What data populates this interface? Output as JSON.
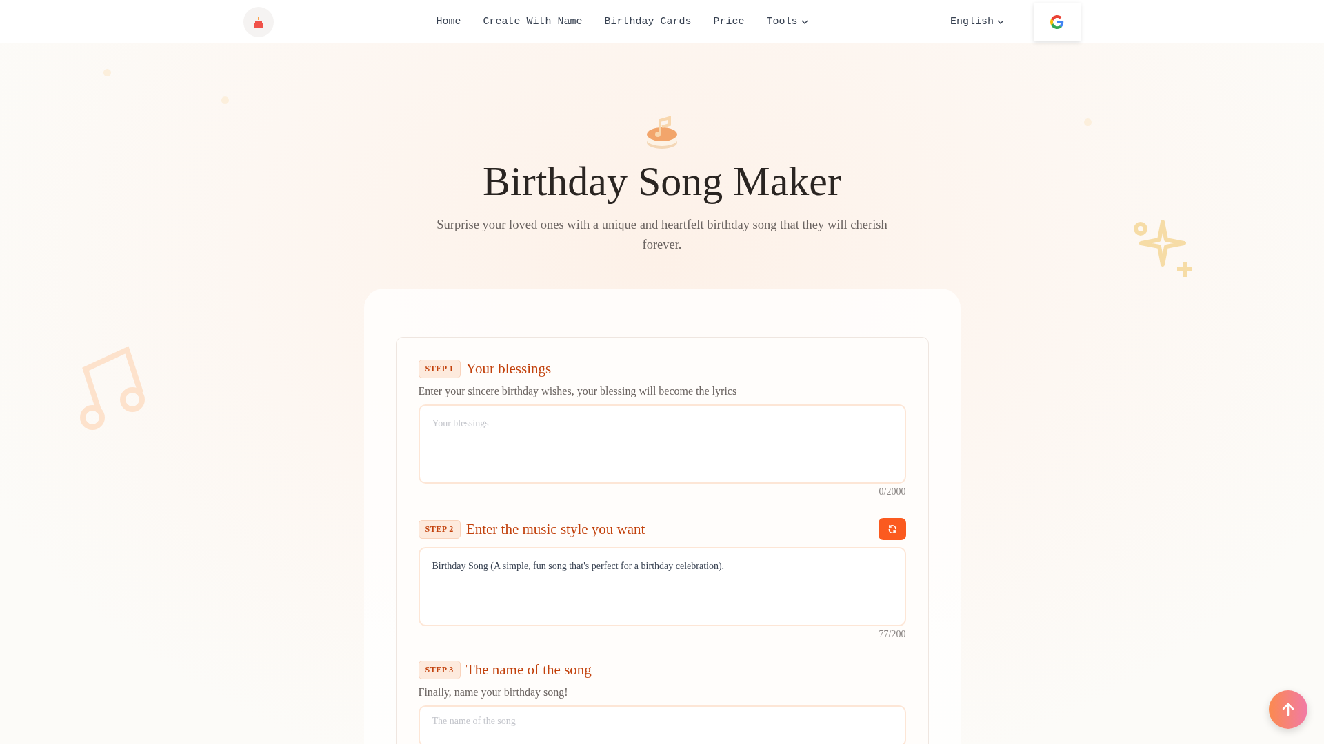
{
  "header": {
    "nav": [
      {
        "label": "Home",
        "kind": "link"
      },
      {
        "label": "Create With Name",
        "kind": "link"
      },
      {
        "label": "Birthday Cards",
        "kind": "link"
      },
      {
        "label": "Price",
        "kind": "link"
      },
      {
        "label": "Tools",
        "kind": "dropdown"
      }
    ],
    "language": "English"
  },
  "hero": {
    "title": "Birthday Song Maker",
    "subtitle": "Surprise your loved ones with a unique and heartfelt birthday song that they will cherish forever."
  },
  "steps": [
    {
      "badge": "STEP 1",
      "title": "Your blessings",
      "description": "Enter your sincere birthday wishes, your blessing will become the lyrics",
      "field": {
        "kind": "textarea",
        "placeholder": "Your blessings",
        "counter": "0/2000"
      }
    },
    {
      "badge": "STEP 2",
      "title": "Enter the music style you want",
      "refresh": true,
      "field": {
        "kind": "textarea",
        "value": "Birthday Song (A simple, fun song that's perfect for a birthday celebration).",
        "counter": "77/200"
      }
    },
    {
      "badge": "STEP 3",
      "title": "The name of the song",
      "description": "Finally, name your birthday song!",
      "field": {
        "kind": "input",
        "placeholder": "The name of the song"
      }
    }
  ]
}
